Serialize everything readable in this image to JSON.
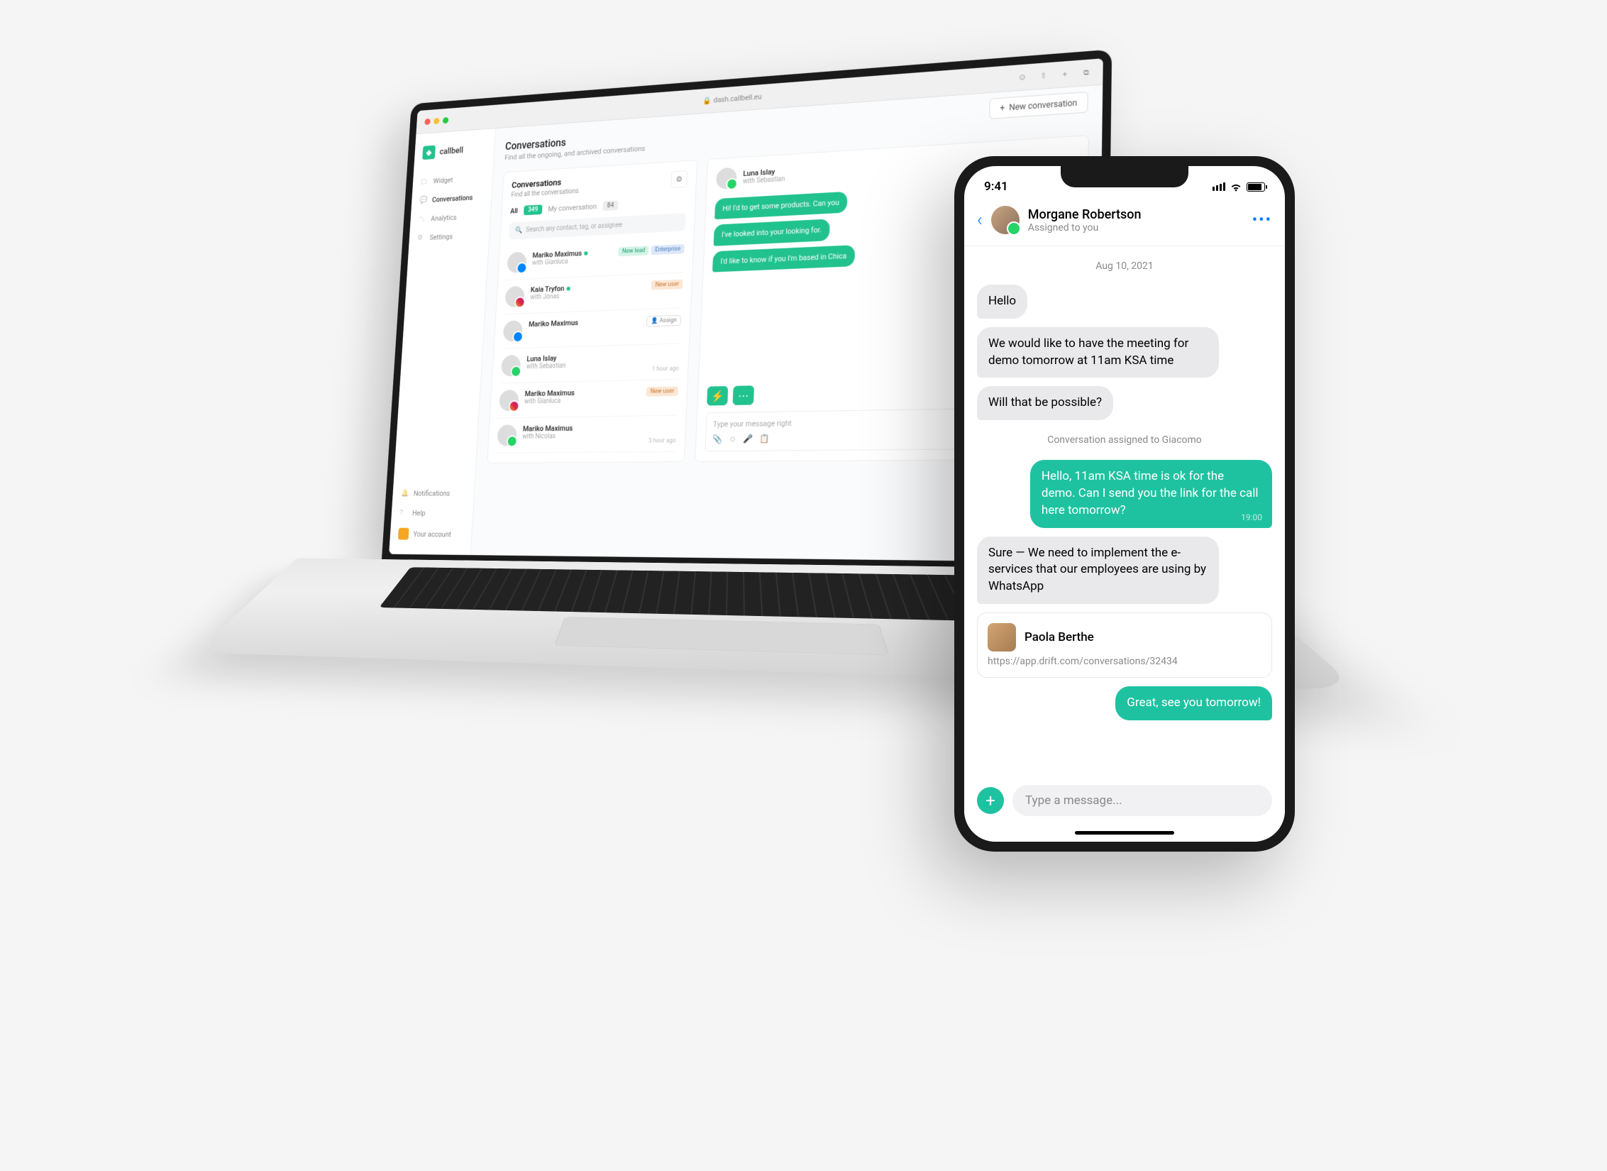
{
  "browser": {
    "url": "dash.callbell.eu"
  },
  "logo": "callbell",
  "nav": {
    "widget": "Widget",
    "conversations": "Conversations",
    "analytics": "Analytics",
    "settings": "Settings"
  },
  "sidebar_bottom": {
    "notifications": "Notifications",
    "help": "Help",
    "account": "Your account"
  },
  "page": {
    "title": "Conversations",
    "subtitle": "Find all the ongoing, and archived conversations"
  },
  "new_conversation": "New conversation",
  "conv_panel": {
    "title": "Conversations",
    "subtitle": "Find all the conversations",
    "filter_all": "All",
    "filter_all_count": "349",
    "filter_mine": "My conversation",
    "filter_mine_count": "84",
    "search_placeholder": "Search any contact, tag, or assignee"
  },
  "conversations": [
    {
      "name": "Mariko Maximus",
      "with": "with Gianluca",
      "tags": [
        {
          "label": "New lead",
          "cls": "green"
        },
        {
          "label": "Enterprise",
          "cls": "blue"
        }
      ],
      "channel": "fb",
      "dot": true
    },
    {
      "name": "Kaia Tryfon",
      "with": "with Jonas",
      "tags": [
        {
          "label": "New user",
          "cls": "orange"
        }
      ],
      "channel": "ig",
      "dot": true
    },
    {
      "name": "Mariko Maximus",
      "with": "",
      "tags": [
        {
          "label": "Assign",
          "cls": "assign"
        }
      ],
      "channel": "fb"
    },
    {
      "name": "Luna Islay",
      "with": "with Sebastian",
      "time": "1 hour ago",
      "channel": "wa"
    },
    {
      "name": "Mariko Maximus",
      "with": "with Gianluca",
      "tags": [
        {
          "label": "New user",
          "cls": "orange"
        }
      ],
      "channel": "ig"
    },
    {
      "name": "Mariko Maximus",
      "with": "with Nicolas",
      "time": "3 hour ago",
      "channel": "wa"
    }
  ],
  "desktop_chat": {
    "name": "Luna Islay",
    "with": "with Sebastian",
    "messages": [
      "Hi! I'd to get some products. Can you",
      "I've looked into your looking for.",
      "I'd like to know if you I'm based in Chica"
    ],
    "input_placeholder": "Type your message right"
  },
  "phone": {
    "time": "9:41",
    "contact_name": "Morgane Robertson",
    "assigned": "Assigned to you",
    "date": "Aug 10, 2021",
    "assignment": "Conversation assigned to Giacomo",
    "messages": [
      {
        "text": "Hello",
        "type": "recv"
      },
      {
        "text": "We would like to have the meeting for demo tomorrow at 11am KSA time",
        "type": "recv"
      },
      {
        "text": "Will that be possible?",
        "type": "recv"
      },
      {
        "text": "Hello, 11am KSA time is ok for the demo. Can I send you the link for the call here tomorrow?",
        "type": "sent",
        "time": "19:00"
      },
      {
        "text": "Sure — We need to implement the e-services that our employees are using by WhatsApp",
        "type": "recv"
      },
      {
        "text": "Great, see you tomorrow!",
        "type": "sent"
      }
    ],
    "link_card": {
      "name": "Paola Berthe",
      "url": "https://app.drift.com/conversations/32434"
    },
    "input_placeholder": "Type a message..."
  }
}
